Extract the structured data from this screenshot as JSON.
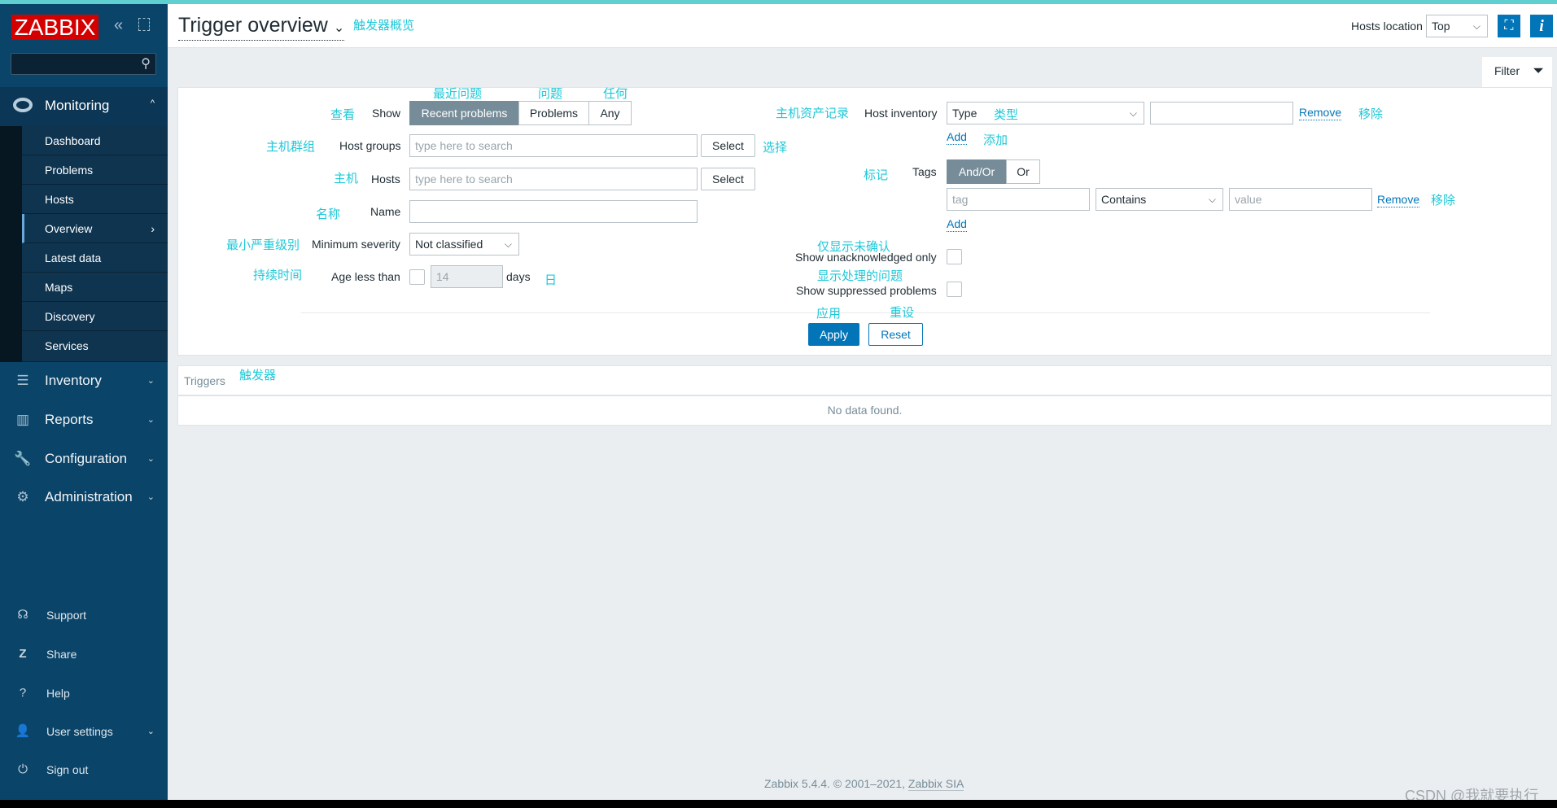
{
  "app": {
    "logo": "ZABBIX",
    "title": "Trigger overview"
  },
  "sidebar": {
    "monitoring": "Monitoring",
    "sub": [
      "Dashboard",
      "Problems",
      "Hosts",
      "Overview",
      "Latest data",
      "Maps",
      "Discovery",
      "Services"
    ],
    "active": "Overview",
    "menus": [
      {
        "label": "Inventory",
        "icon": "list-icon"
      },
      {
        "label": "Reports",
        "icon": "bar-chart-icon"
      },
      {
        "label": "Configuration",
        "icon": "wrench-icon"
      },
      {
        "label": "Administration",
        "icon": "gear-icon"
      }
    ],
    "bottom": [
      {
        "label": "Support",
        "icon": "headset-icon"
      },
      {
        "label": "Share",
        "icon": "share-z-icon"
      },
      {
        "label": "Help",
        "icon": "question-icon"
      },
      {
        "label": "User settings",
        "icon": "user-icon"
      },
      {
        "label": "Sign out",
        "icon": "power-icon"
      }
    ]
  },
  "header": {
    "hosts_location_label": "Hosts location",
    "hosts_location_value": "Top"
  },
  "filter": {
    "tab": "Filter",
    "show_label": "Show",
    "show_options": [
      "Recent problems",
      "Problems",
      "Any"
    ],
    "show_selected": "Recent problems",
    "host_groups_label": "Host groups",
    "host_groups_placeholder": "type here to search",
    "hosts_label": "Hosts",
    "hosts_placeholder": "type here to search",
    "select": "Select",
    "name_label": "Name",
    "name_value": "",
    "min_severity_label": "Minimum severity",
    "min_severity_value": "Not classified",
    "age_label": "Age less than",
    "age_value": "14",
    "age_unit": "days",
    "host_inventory_label": "Host inventory",
    "inventory_field": "Type",
    "inventory_value": "",
    "remove": "Remove",
    "add": "Add",
    "tags_label": "Tags",
    "tags_options": [
      "And/Or",
      "Or"
    ],
    "tags_selected": "And/Or",
    "tag_placeholder": "tag",
    "tag_operator": "Contains",
    "value_placeholder": "value",
    "unack_label": "Show unacknowledged only",
    "suppressed_label": "Show suppressed problems",
    "apply": "Apply",
    "reset": "Reset"
  },
  "annotations": {
    "title": "触发器概览",
    "recent": "最近问题",
    "problems": "问题",
    "any": "任何",
    "show": "查看",
    "host_groups": "主机群组",
    "select": "选择",
    "hosts": "主机",
    "name": "名称",
    "min_severity": "最小严重级别",
    "age": "持续时间",
    "days": "日",
    "inventory": "主机资产记录",
    "type": "类型",
    "remove": "移除",
    "add": "添加",
    "tags": "标记",
    "unack": "仅显示未确认",
    "suppressed": "显示处理的问题",
    "apply": "应用",
    "reset": "重设",
    "triggers": "触发器"
  },
  "triggers": {
    "header": "Triggers",
    "empty": "No data found."
  },
  "footer": {
    "text": "Zabbix 5.4.4. © 2001–2021,",
    "link": "Zabbix SIA"
  },
  "watermark": "CSDN @我就要执行",
  "colors": {
    "sidebar": "#0b4469",
    "accent": "#0275b8",
    "annotation": "#1ec8d8",
    "logo": "#d40000"
  }
}
